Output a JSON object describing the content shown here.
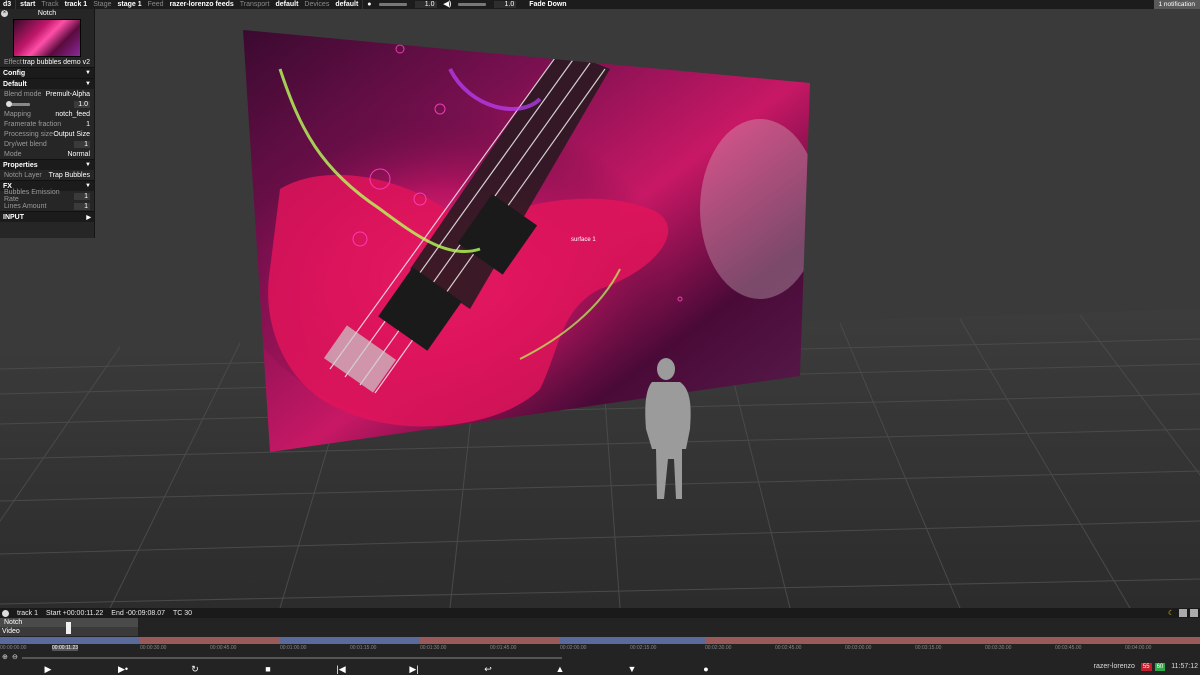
{
  "topbar": {
    "app": "d3",
    "start": "start",
    "track_label": "Track",
    "track_value": "track 1",
    "stage_label": "Stage",
    "stage_value": "stage 1",
    "feed_label": "Feed",
    "feed_value": "razer-lorenzo feeds",
    "transport_label": "Transport",
    "transport_value": "default",
    "devices_label": "Devices",
    "devices_value": "default",
    "volume_a": "1.0",
    "volume_b": "1.0",
    "fade": "Fade Down",
    "notification": "1 notification"
  },
  "panel": {
    "title": "Notch",
    "close": "×",
    "effect_label": "Effect",
    "effect_value": "trap bubbles demo v2",
    "sections": {
      "config": "Config",
      "default": "Default",
      "properties": "Properties",
      "fx": "FX",
      "input": "INPUT"
    },
    "rows": {
      "blend_mode_k": "Blend mode",
      "blend_mode_v": "Premult-Alpha",
      "brightness_v": "1.0",
      "mapping_k": "Mapping",
      "mapping_v": "notch_feed",
      "framerate_k": "Framerate fraction",
      "framerate_v": "1",
      "processing_k": "Processing size",
      "processing_v": "Output Size",
      "drywet_k": "Dry/wet blend",
      "drywet_v": "1",
      "mode_k": "Mode",
      "mode_v": "Normal",
      "notch_layer_k": "Notch Layer",
      "notch_layer_v": "Trap Bubbles",
      "bubbles_k": "Bubbles Emission Rate",
      "bubbles_v": "1",
      "lines_k": "Lines Amount",
      "lines_v": "1"
    }
  },
  "viewport": {
    "surface_label": "surface 1"
  },
  "timeline": {
    "track": "track 1",
    "start": "Start +00:00:11.22",
    "end": "End -00:09:08.07",
    "tc": "TC 30",
    "layer_name": "Notch",
    "layer_type": "Video",
    "times": [
      "00:00:00.00",
      "00:00:11.23",
      "00:00:30.00",
      "00:00:45.00",
      "00:01:00.00",
      "00:01:15.00",
      "00:01:30.00",
      "00:01:45.00",
      "00:02:00.00",
      "00:02:15.00",
      "00:02:30.00",
      "00:02:45.00",
      "00:03:00.00",
      "00:03:15.00",
      "00:03:30.00",
      "00:03:45.00",
      "00:04:00.00"
    ],
    "status_user": "razer-lorenzo",
    "status_fps": "55",
    "status_ok": "60",
    "clock": "11:57:12"
  },
  "icons": {
    "play": "▶",
    "play_section": "▶•",
    "loop": "↻",
    "stop": "■",
    "prev": "|◀",
    "next": "▶|",
    "return": "↩",
    "up": "▲",
    "down": "▼",
    "record": "●"
  }
}
